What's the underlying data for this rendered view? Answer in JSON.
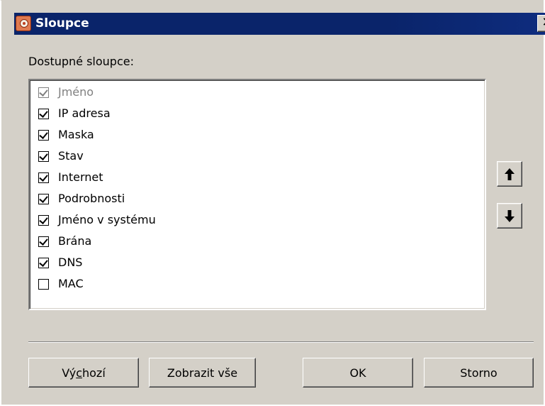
{
  "window": {
    "title": "Sloupce",
    "close_label": "✕"
  },
  "main": {
    "list_label": "Dostupné sloupce:",
    "columns": [
      {
        "label": "Jméno",
        "checked": true,
        "disabled": true
      },
      {
        "label": "IP adresa",
        "checked": true,
        "disabled": false
      },
      {
        "label": "Maska",
        "checked": true,
        "disabled": false
      },
      {
        "label": "Stav",
        "checked": true,
        "disabled": false
      },
      {
        "label": "Internet",
        "checked": true,
        "disabled": false
      },
      {
        "label": "Podrobnosti",
        "checked": true,
        "disabled": false
      },
      {
        "label": "Jméno v systému",
        "checked": true,
        "disabled": false
      },
      {
        "label": "Brána",
        "checked": true,
        "disabled": false
      },
      {
        "label": "DNS",
        "checked": true,
        "disabled": false
      },
      {
        "label": "MAC",
        "checked": false,
        "disabled": false
      }
    ],
    "move_up_icon": "arrow-up-icon",
    "move_down_icon": "arrow-down-icon"
  },
  "footer": {
    "default_prefix": "Vý",
    "default_mnemonic": "c",
    "default_suffix": "hozí",
    "show_all_label": "Zobrazit vše",
    "ok_label": "OK",
    "cancel_label": "Storno"
  },
  "colors": {
    "titlebar": "#0a246a",
    "dialog_face": "#d4d0c8",
    "disabled_text": "#808080"
  }
}
